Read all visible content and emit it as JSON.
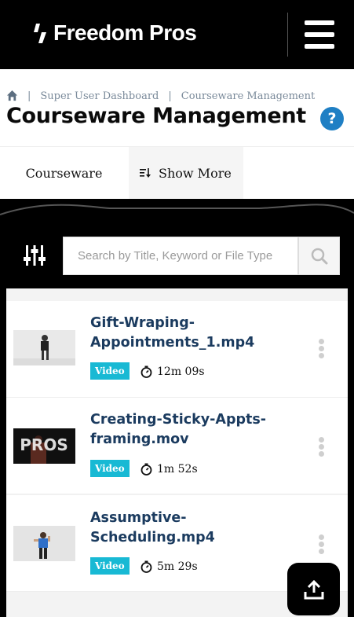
{
  "header": {
    "logo_text": "Freedom Pros",
    "menu_icon": "hamburger-icon"
  },
  "breadcrumb": {
    "home_icon": "home-icon",
    "items": [
      "Super User Dashboard",
      "Courseware Management"
    ],
    "separator": "|"
  },
  "page": {
    "title": "Courseware Management",
    "help_label": "?"
  },
  "tabs": {
    "courseware": "Courseware",
    "show_more": "Show More"
  },
  "search": {
    "placeholder": "Search by Title, Keyword or File Type",
    "filter_icon": "sliders-icon",
    "search_icon": "search-icon"
  },
  "items": [
    {
      "title": "Gift-Wraping-Appointments_1.mp4",
      "type": "Video",
      "duration": "12m 09s"
    },
    {
      "title": "Creating-Sticky-Appts-framing.mov",
      "type": "Video",
      "duration": "1m 52s"
    },
    {
      "title": "Assumptive-Scheduling.mp4",
      "type": "Video",
      "duration": "5m 29s"
    }
  ],
  "colors": {
    "accent": "#18b9d4",
    "title_blue": "#1b3b5f",
    "help_blue": "#1f7fc4"
  },
  "upload_icon": "upload-icon"
}
